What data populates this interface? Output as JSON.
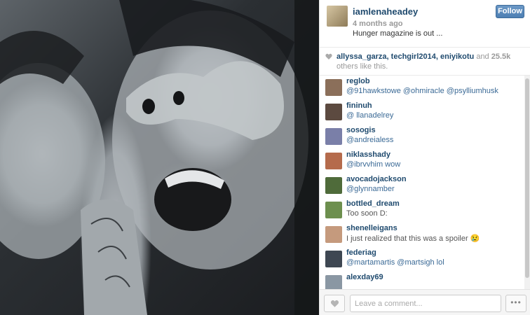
{
  "post": {
    "username": "iamlenaheadey",
    "time": "4 months ago",
    "caption": "Hunger magazine is out ...",
    "follow_label": "Follow"
  },
  "likes": {
    "names": "allyssa_garza, techgirl2014, eniyikotu",
    "and_text": " and ",
    "count": "25.5k",
    "suffix": " others like this."
  },
  "comments": [
    {
      "user": "reglob",
      "text": "@91hawkstowe @ohmiracle @psylliumhusk",
      "mention": true,
      "avatar_color": "#8b6f5a"
    },
    {
      "user": "fininuh",
      "text": "@ llanadelrey",
      "mention": true,
      "avatar_color": "#5c4a40"
    },
    {
      "user": "sosogis",
      "text": "@andreialess",
      "mention": true,
      "avatar_color": "#7a7fa8"
    },
    {
      "user": "niklasshady",
      "text": "@ibrvvhim wow",
      "mention": true,
      "avatar_color": "#b56b4c"
    },
    {
      "user": "avocadojackson",
      "text": "@glynnamber",
      "mention": true,
      "avatar_color": "#4f6b3a"
    },
    {
      "user": "bottled_dream",
      "text": "Too soon D:",
      "mention": false,
      "avatar_color": "#6d8f4e"
    },
    {
      "user": "shenelleigans",
      "text": "I just realized that this was a spoiler 😢",
      "mention": false,
      "avatar_color": "#c59a7d"
    },
    {
      "user": "federiag",
      "text": "@martamartis @martsigh lol",
      "mention": true,
      "avatar_color": "#3e4752"
    },
    {
      "user": "alexday69",
      "text": "",
      "mention": false,
      "avatar_color": "#8a97a3"
    }
  ],
  "footer": {
    "comment_placeholder": "Leave a comment...",
    "more_label": "•••"
  },
  "icons": {
    "like": "heart-icon",
    "more": "more-icon"
  },
  "colors": {
    "link": "#1f4a6e",
    "follow_button": "#4d7fb3"
  }
}
